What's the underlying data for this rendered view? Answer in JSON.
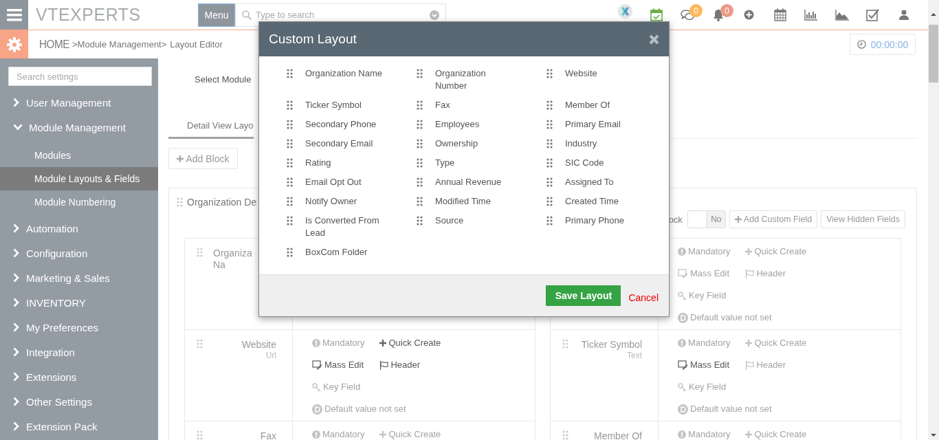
{
  "topbar": {
    "logo": "VTEXPERTS",
    "menu_button": "Menu",
    "search": {
      "placeholder": "Type to search"
    },
    "icons": [
      {
        "kind": "brand"
      },
      {
        "kind": "calendar_check"
      },
      {
        "kind": "chat",
        "badge": "0",
        "color": "#fcb859"
      },
      {
        "kind": "bell",
        "badge": "0",
        "color": "#ec9a87"
      },
      {
        "kind": "plus"
      },
      {
        "kind": "calendar"
      },
      {
        "kind": "bar_chart"
      },
      {
        "kind": "area_chart"
      },
      {
        "kind": "checkbox"
      },
      {
        "kind": "user"
      }
    ]
  },
  "breadcrumb": {
    "home": "HOME",
    "path": ">Module Management>",
    "current": "Layout Editor"
  },
  "timer": "00:00:00",
  "sidebar": {
    "search": {
      "placeholder": "Search settings"
    },
    "items": [
      {
        "label": "User Management",
        "expanded": false
      },
      {
        "label": "Module Management",
        "expanded": true,
        "children": [
          {
            "label": "Modules",
            "selected": false
          },
          {
            "label": "Module Layouts & Fields",
            "selected": true
          },
          {
            "label": "Module Numbering",
            "selected": false
          }
        ]
      },
      {
        "label": "Automation",
        "expanded": false
      },
      {
        "label": "Configuration",
        "expanded": false
      },
      {
        "label": "Marketing & Sales",
        "expanded": false
      },
      {
        "label": "INVENTORY",
        "expanded": false
      },
      {
        "label": "My Preferences",
        "expanded": false
      },
      {
        "label": "Integration",
        "expanded": false
      },
      {
        "label": "Extensions",
        "expanded": false
      },
      {
        "label": "Other Settings",
        "expanded": false
      },
      {
        "label": "Extension Pack",
        "expanded": false
      }
    ]
  },
  "main": {
    "select_module_label": "Select Module",
    "tabs": [
      {
        "label": "Detail View Layo",
        "selected": true
      }
    ],
    "add_block": "Add Block",
    "block": {
      "title": "Organization De",
      "toggle_label": "ock",
      "toggle": {
        "on": false,
        "text": "No"
      },
      "buttons": [
        {
          "kind": "add",
          "label": "Add Custom Field"
        },
        {
          "kind": "plain",
          "label": "View Hidden Fields"
        }
      ],
      "fields": [
        {
          "label_lines": [
            "Organiza",
            "Na"
          ]
        },
        {
          "checks": [
            {
              "kind": "mandatory",
              "label": "Mandatory",
              "enabled": false
            },
            {
              "kind": "quick_create",
              "label": "Quick Create",
              "enabled": false
            },
            {
              "kind": "mass_edit",
              "label": "Mass Edit",
              "enabled": false
            },
            {
              "kind": "header",
              "label": "Header",
              "enabled": false
            },
            {
              "kind": "key_field",
              "label": "Key Field",
              "enabled": false
            },
            {
              "kind": "default",
              "label": "Default value not set",
              "enabled": false
            }
          ]
        },
        {
          "label": "Website",
          "type": "Url",
          "checks": [
            {
              "kind": "mandatory",
              "label": "Mandatory",
              "enabled": false
            },
            {
              "kind": "quick_create",
              "label": "Quick Create",
              "enabled": true
            },
            {
              "kind": "mass_edit",
              "label": "Mass Edit",
              "enabled": true
            },
            {
              "kind": "header",
              "label": "Header",
              "enabled": true
            },
            {
              "kind": "key_field",
              "label": "Key Field",
              "enabled": false
            },
            {
              "kind": "default",
              "label": "Default value not set",
              "enabled": false
            }
          ]
        },
        {
          "label": "Ticker Symbol",
          "type": "Text",
          "checks": [
            {
              "kind": "mandatory",
              "label": "Mandatory",
              "enabled": false
            },
            {
              "kind": "quick_create",
              "label": "Quick Create",
              "enabled": false
            },
            {
              "kind": "mass_edit",
              "label": "Mass Edit",
              "enabled": true
            },
            {
              "kind": "header",
              "label": "Header",
              "enabled": false
            },
            {
              "kind": "key_field",
              "label": "Key Field",
              "enabled": false
            },
            {
              "kind": "default",
              "label": "Default value not set",
              "enabled": false
            }
          ]
        },
        {
          "label": "Fax",
          "checks": [
            {
              "kind": "mandatory",
              "label": "Mandatory",
              "enabled": false
            },
            {
              "kind": "quick_create",
              "label": "Quick Create",
              "enabled": false
            }
          ]
        },
        {
          "label": "Member Of",
          "checks": [
            {
              "kind": "mandatory",
              "label": "Mandatory",
              "enabled": false
            },
            {
              "kind": "quick_create",
              "label": "Quick Create",
              "enabled": false
            }
          ]
        }
      ]
    }
  },
  "modal": {
    "title": "Custom Layout",
    "fields": [
      "Organization Name",
      "Organization Number",
      "Website",
      "Ticker Symbol",
      "Fax",
      "Member Of",
      "Secondary Phone",
      "Employees",
      "Primary Email",
      "Secondary Email",
      "Ownership",
      "Industry",
      "Rating",
      "Type",
      "SIC Code",
      "Email Opt Out",
      "Annual Revenue",
      "Assigned To",
      "Notify Owner",
      "Modified Time",
      "Created Time",
      "Is Converted From Lead",
      "Source",
      "Primary Phone",
      "BoxCom Folder"
    ],
    "save": "Save Layout",
    "cancel": "Cancel"
  }
}
